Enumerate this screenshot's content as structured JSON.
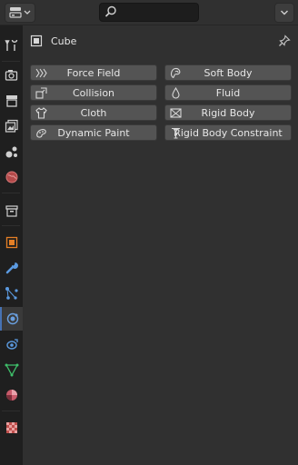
{
  "header": {
    "search_placeholder": ""
  },
  "tabs": [
    {
      "name": "tool",
      "icon": "tool-icon"
    },
    {
      "name": "render",
      "icon": "render-icon"
    },
    {
      "name": "output",
      "icon": "output-icon"
    },
    {
      "name": "view-layer",
      "icon": "view-layer-icon"
    },
    {
      "name": "scene",
      "icon": "scene-icon"
    },
    {
      "name": "world",
      "icon": "world-icon"
    },
    {
      "name": "collection",
      "icon": "collection-icon"
    },
    {
      "name": "object",
      "icon": "object-icon"
    },
    {
      "name": "modifiers",
      "icon": "wrench-icon"
    },
    {
      "name": "particles",
      "icon": "particles-icon"
    },
    {
      "name": "physics",
      "icon": "physics-icon",
      "active": true
    },
    {
      "name": "constraints",
      "icon": "constraints-icon"
    },
    {
      "name": "data",
      "icon": "mesh-data-icon"
    },
    {
      "name": "material",
      "icon": "material-icon"
    },
    {
      "name": "texture",
      "icon": "texture-icon"
    }
  ],
  "panel": {
    "object_name": "Cube",
    "buttons_left": [
      "Force Field",
      "Collision",
      "Cloth",
      "Dynamic Paint"
    ],
    "buttons_right": [
      "Soft Body",
      "Fluid",
      "Rigid Body",
      "Rigid Body Constraint"
    ]
  },
  "colors": {
    "background": "#303030",
    "tab_bar": "#1f1f1f",
    "button": "#545454",
    "accent": "#4772b3",
    "object_orange": "#e57f26"
  }
}
